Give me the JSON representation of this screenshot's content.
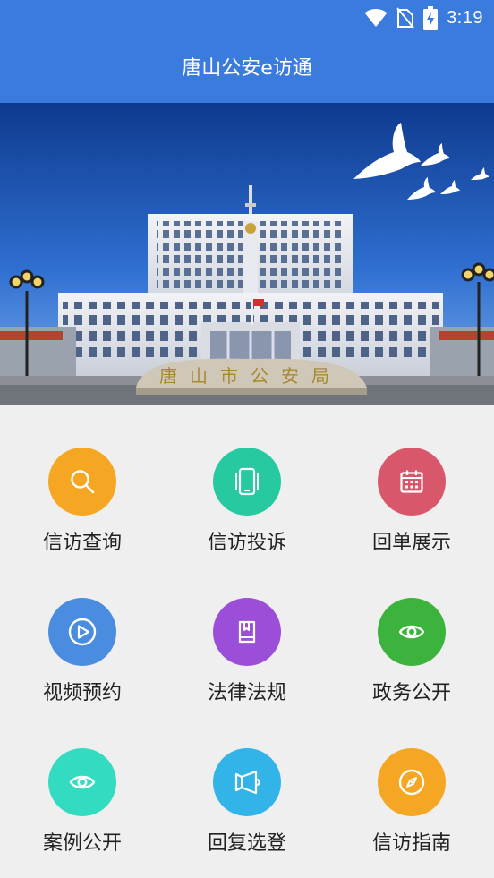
{
  "status_bar": {
    "time": "3:19",
    "icons": [
      "wifi-icon",
      "no-sim-icon",
      "battery-charging-icon"
    ]
  },
  "app_bar": {
    "title": "唐山公安e访通"
  },
  "hero": {
    "image": "police-headquarters-banner",
    "sign_text": "唐山市公安局"
  },
  "menu": [
    {
      "label": "信访查询",
      "icon": "search-icon",
      "color": "#f5a623"
    },
    {
      "label": "信访投诉",
      "icon": "phone-icon",
      "color": "#26c9a0"
    },
    {
      "label": "回单展示",
      "icon": "calendar-icon",
      "color": "#d9576b"
    },
    {
      "label": "视频预约",
      "icon": "play-icon",
      "color": "#4a8de0"
    },
    {
      "label": "法律法规",
      "icon": "book-icon",
      "color": "#9b4fd9"
    },
    {
      "label": "政务公开",
      "icon": "eye-icon",
      "color": "#3cb33c"
    },
    {
      "label": "案例公开",
      "icon": "eye-icon",
      "color": "#33dcc0"
    },
    {
      "label": "回复选登",
      "icon": "megaphone-icon",
      "color": "#33b4e8"
    },
    {
      "label": "信访指南",
      "icon": "compass-icon",
      "color": "#f5a623"
    }
  ]
}
